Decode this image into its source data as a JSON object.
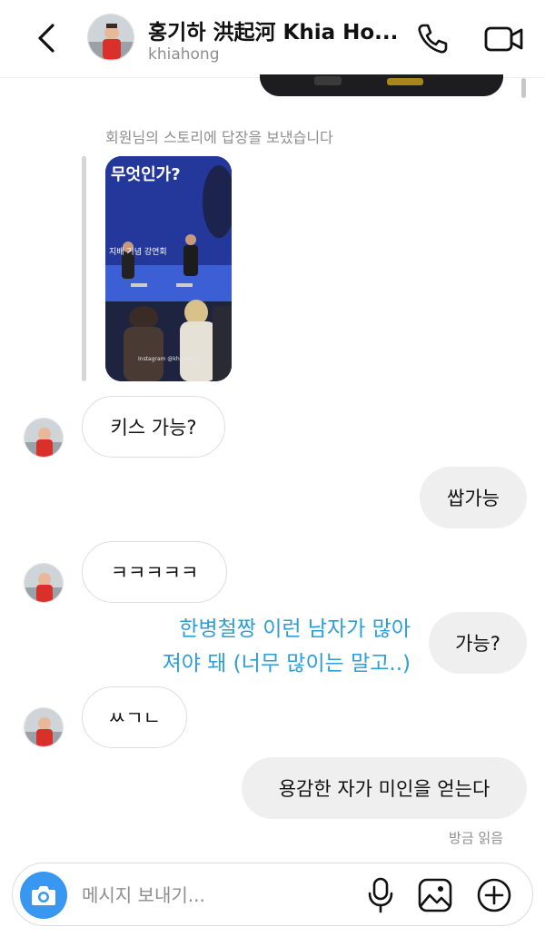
{
  "header": {
    "display_name": "홍기하 洪起河 Khia Ho...",
    "username": "khiahong"
  },
  "story_reply": {
    "note": "회원님의 스토리에 답장을 보냈습니다",
    "title": "무엇인가?",
    "banner": "지배 기념 강연회",
    "credit": "Instagram @khiahong"
  },
  "messages": [
    {
      "side": "in",
      "text": "키스 가능?"
    },
    {
      "side": "out",
      "text": "쌉가능"
    },
    {
      "side": "in",
      "text": "ㅋㅋㅋㅋㅋ"
    },
    {
      "side": "out",
      "text": "가능?"
    },
    {
      "side": "in",
      "text": "ㅆㄱㄴ"
    },
    {
      "side": "out",
      "text": "용감한 자가 미인을 얻는다"
    }
  ],
  "overlay_text": {
    "line1": "한병철짱 이런 남자가 많아",
    "line2": "져야 돼 (너무 많이는 말고..)"
  },
  "read_receipt": "방금 읽음",
  "composer": {
    "placeholder": "메시지 보내기..."
  },
  "colors": {
    "accent": "#3897f0",
    "overlay_text": "#2e9ed6",
    "outgoing_bubble": "#efefef"
  },
  "icons": [
    "back-arrow-icon",
    "phone-icon",
    "video-camera-icon",
    "camera-icon",
    "microphone-icon",
    "image-icon",
    "plus-circle-icon"
  ]
}
